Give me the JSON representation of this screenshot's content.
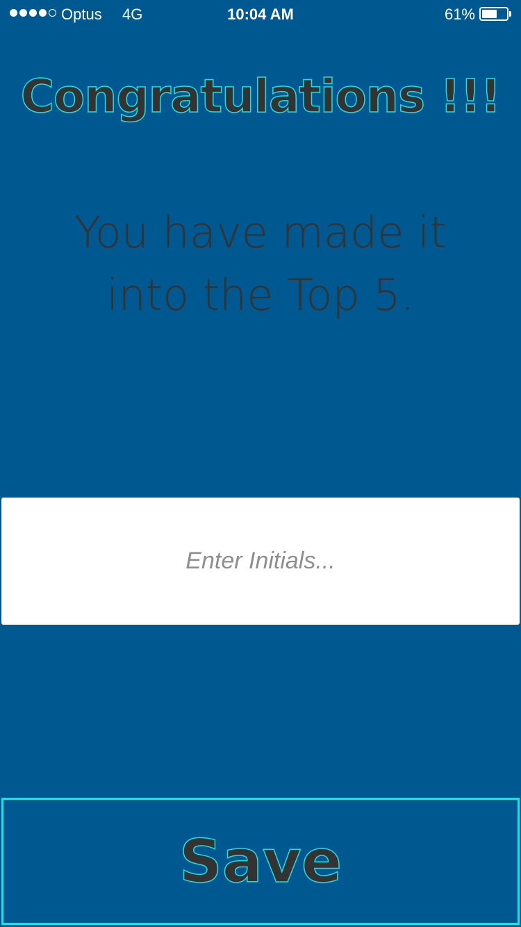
{
  "status_bar": {
    "carrier": "Optus",
    "network": "4G",
    "time": "10:04 AM",
    "battery_percent": "61%",
    "battery_level": 0.61,
    "signal_bars_filled": 4,
    "signal_bars_total": 5
  },
  "header": {
    "title": "Congratulations !!!"
  },
  "message": {
    "line1": "You have made it",
    "line2": "into the Top 5."
  },
  "initials_field": {
    "value": "",
    "placeholder": "Enter Initials..."
  },
  "save_button": {
    "label": "Save"
  },
  "colors": {
    "background": "#005891",
    "accent": "#22dede",
    "text": "#333333"
  }
}
